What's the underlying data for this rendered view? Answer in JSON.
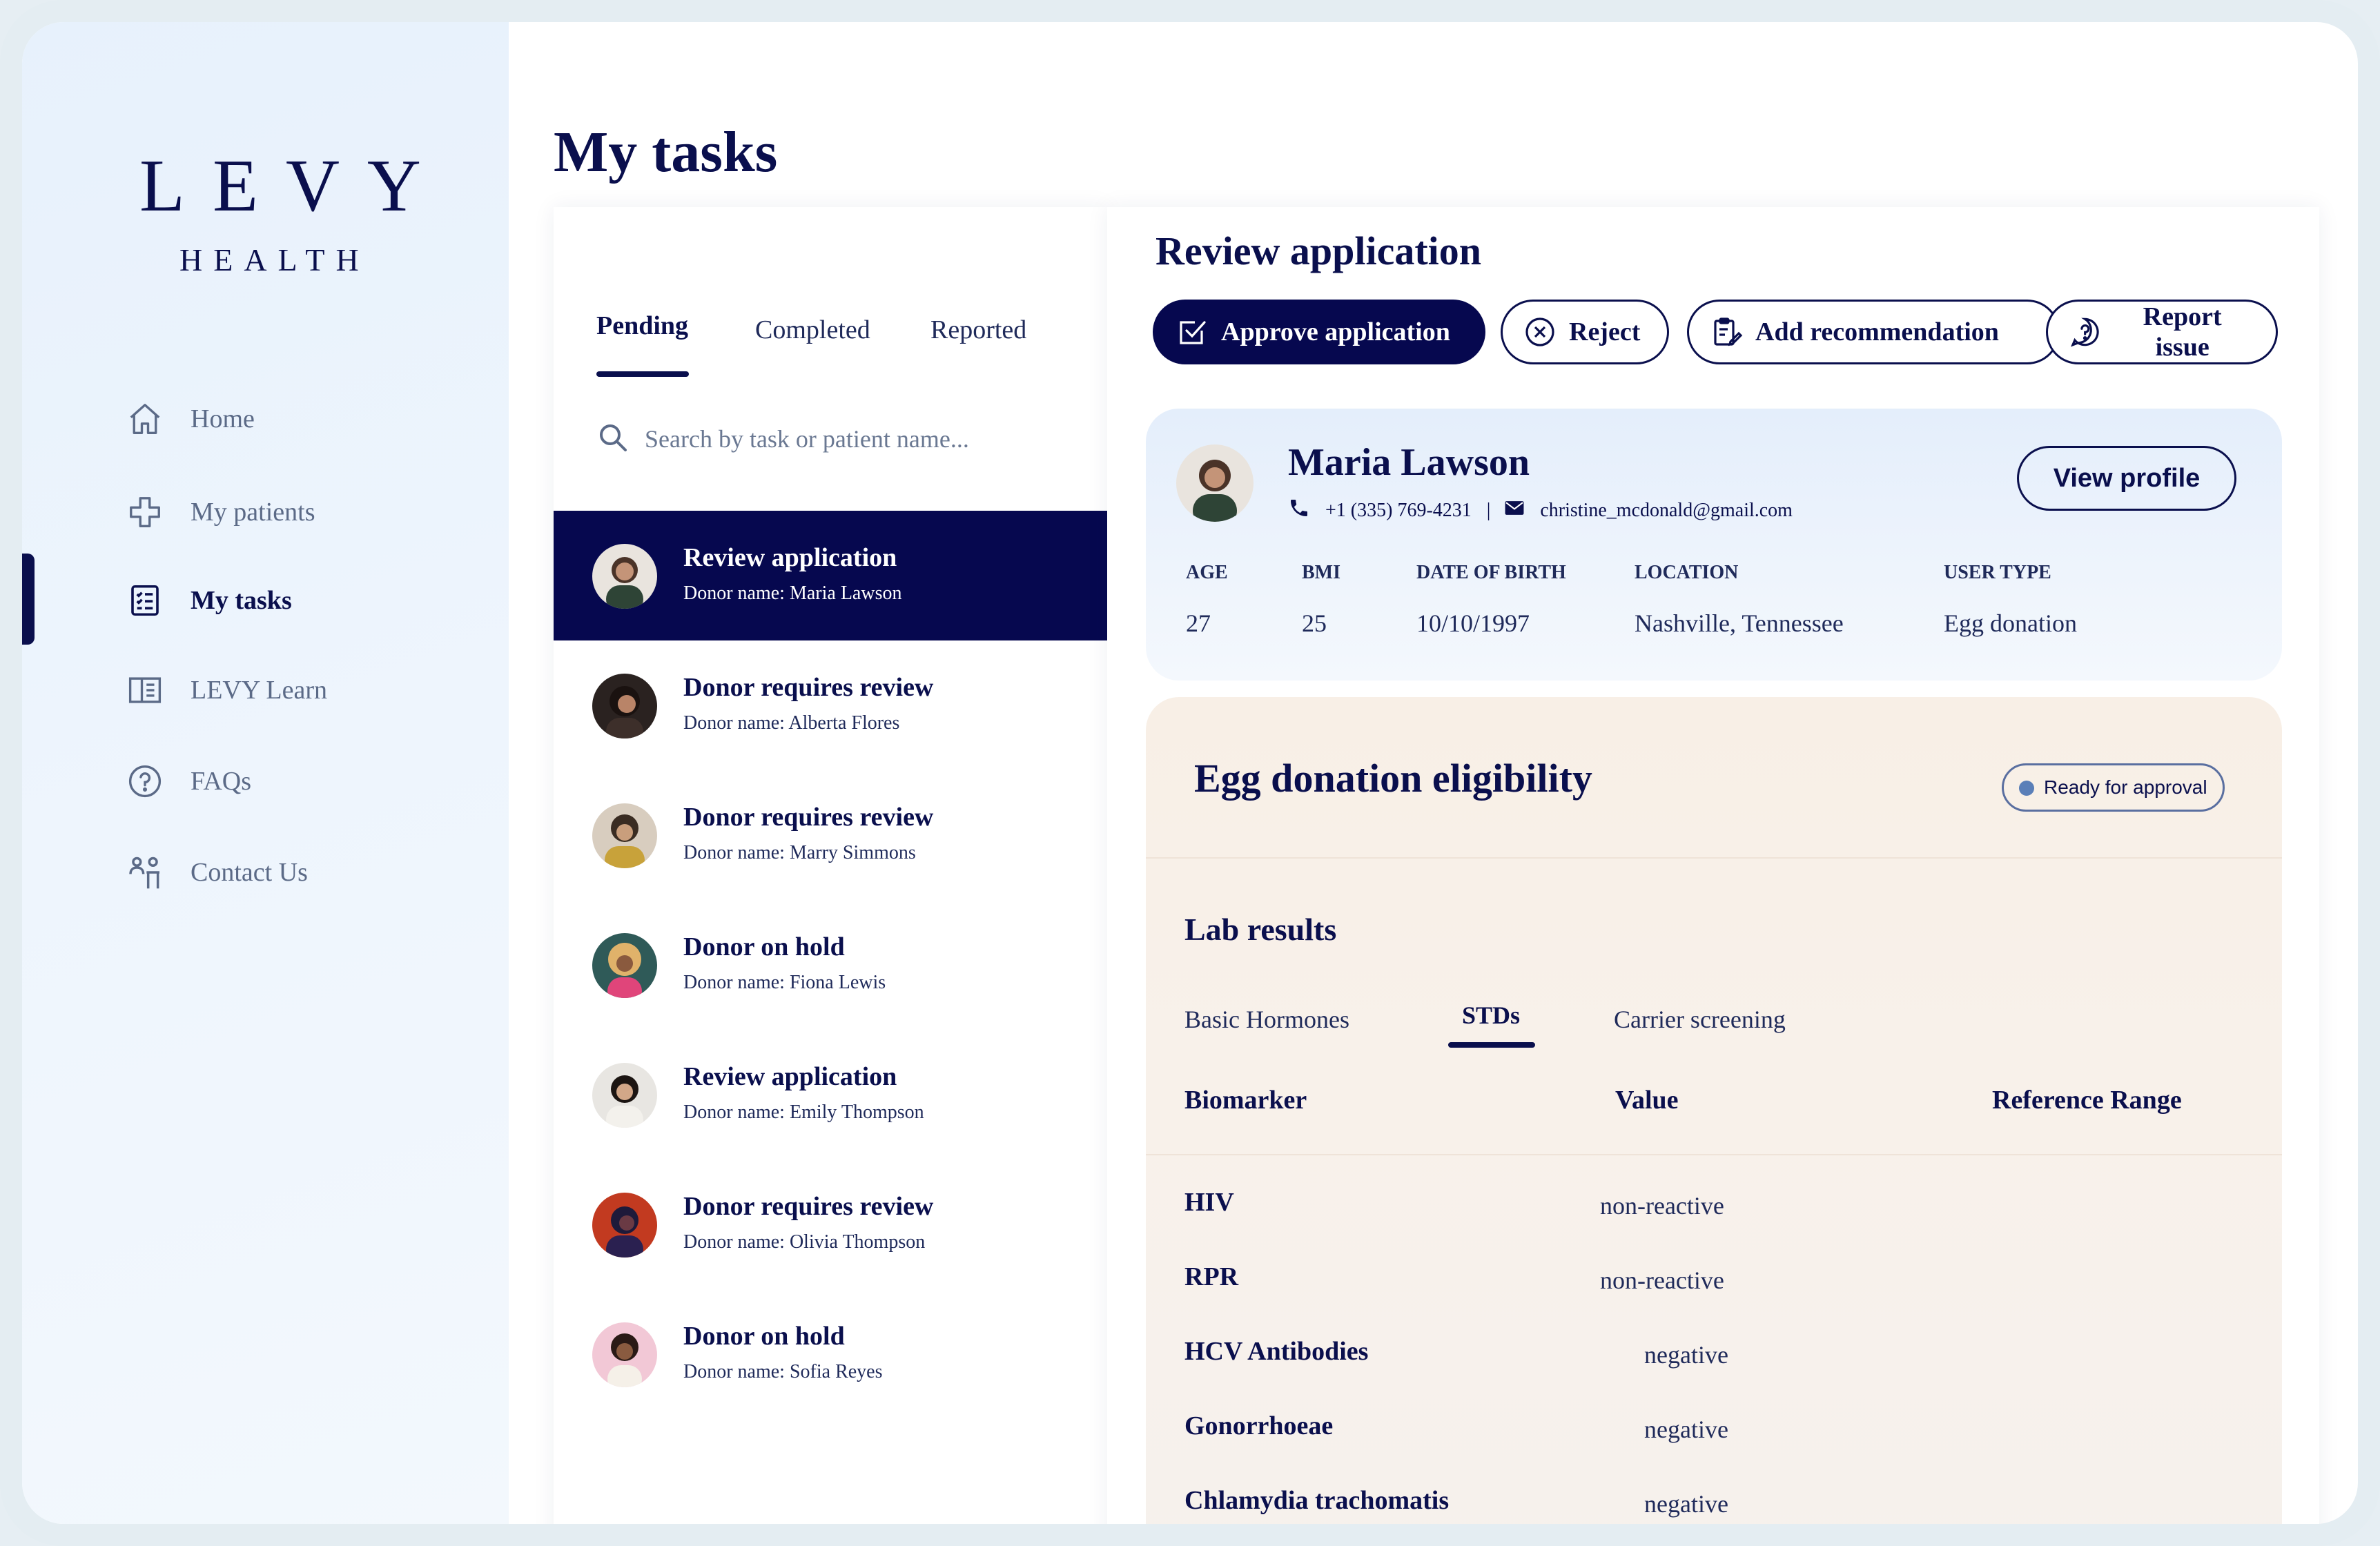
{
  "brand": {
    "name": "LEVY",
    "sub": "HEALTH"
  },
  "nav": {
    "items": [
      {
        "label": "Home",
        "icon": "home-icon"
      },
      {
        "label": "My patients",
        "icon": "medical-cross-icon"
      },
      {
        "label": "My tasks",
        "icon": "task-list-icon",
        "active": true
      },
      {
        "label": "LEVY Learn",
        "icon": "book-icon"
      },
      {
        "label": "FAQs",
        "icon": "question-circle-icon"
      },
      {
        "label": "Contact Us",
        "icon": "people-icon"
      }
    ]
  },
  "page": {
    "title": "My tasks"
  },
  "tasks": {
    "tabs": [
      "Pending",
      "Completed",
      "Reported"
    ],
    "active_tab": "Pending",
    "search_placeholder": "Search by task or patient name...",
    "items": [
      {
        "title": "Review application",
        "donor": "Donor name: Maria Lawson",
        "active": true
      },
      {
        "title": "Donor requires review",
        "donor": "Donor name: Alberta Flores"
      },
      {
        "title": "Donor requires review",
        "donor": "Donor name: Marry Simmons"
      },
      {
        "title": "Donor on hold",
        "donor": "Donor name: Fiona Lewis"
      },
      {
        "title": "Review application",
        "donor": "Donor name: Emily Thompson"
      },
      {
        "title": "Donor requires review",
        "donor": "Donor name: Olivia Thompson"
      },
      {
        "title": "Donor on hold",
        "donor": "Donor name: Sofia Reyes"
      }
    ]
  },
  "review": {
    "title": "Review application",
    "actions": {
      "approve": "Approve application",
      "reject": "Reject",
      "recommend": "Add recommendation",
      "report": "Report issue"
    }
  },
  "profile": {
    "name": "Maria Lawson",
    "phone": "+1 (335) 769-4231",
    "separator": "|",
    "email": "christine_mcdonald@gmail.com",
    "view_profile": "View profile",
    "fields": [
      {
        "label": "AGE",
        "value": "27"
      },
      {
        "label": "BMI",
        "value": "25"
      },
      {
        "label": "DATE OF BIRTH",
        "value": "10/10/1997"
      },
      {
        "label": "LOCATION",
        "value": "Nashville, Tennessee"
      },
      {
        "label": "USER TYPE",
        "value": "Egg donation"
      }
    ]
  },
  "eligibility": {
    "title": "Egg donation eligibility",
    "status": "Ready for approval",
    "lab_title": "Lab results",
    "lab_tabs": [
      "Basic Hormones",
      "STDs",
      "Carrier screening"
    ],
    "active_lab_tab": "STDs",
    "columns": [
      "Biomarker",
      "Value",
      "Reference Range"
    ],
    "rows": [
      {
        "name": "HIV",
        "value": "non-reactive"
      },
      {
        "name": "RPR",
        "value": "non-reactive"
      },
      {
        "name": "HCV Antibodies",
        "value": "negative"
      },
      {
        "name": "Gonorrhoeae",
        "value": "negative"
      },
      {
        "name": "Chlamydia trachomatis",
        "value": "negative"
      }
    ]
  },
  "colors": {
    "navy": "#0a0f4d",
    "active_row": "#06084f",
    "profile_bg": "#e4eefb",
    "eligibility_bg": "#f8efe6",
    "status_dot": "#5a7fb8"
  }
}
